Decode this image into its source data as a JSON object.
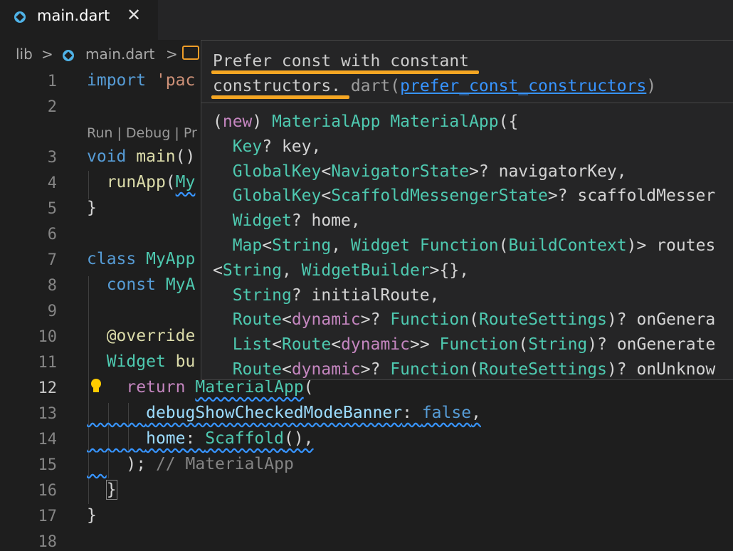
{
  "tab": {
    "title": "main.dart",
    "close": "✕"
  },
  "breadcrumb": {
    "root": "lib",
    "sep": ">",
    "file": "main.dart"
  },
  "codelens": "Run | Debug | Pr",
  "lines": [
    "1",
    "2",
    "3",
    "4",
    "5",
    "6",
    "7",
    "8",
    "9",
    "10",
    "11",
    "12",
    "13",
    "14",
    "15",
    "16",
    "17",
    "18"
  ],
  "code": {
    "l1_kw": "import",
    "l1_str": "'pac",
    "l3_kw": "void",
    "l3_fn": "main",
    "l3_p": "()",
    "l4_fn": "runApp",
    "l4_p": "(",
    "l4_ty": "My",
    "l5": "}",
    "l7_kw": "class",
    "l7_ty": "MyApp",
    "l8_kw": "const",
    "l8_ty": "MyA",
    "l10": "@override",
    "l11_ty": "Widget",
    "l11_fn": "bu",
    "l12_kw": "return",
    "l12_ty": "MaterialApp",
    "l12_p": "(",
    "l13_var": "debugShowCheckedModeBanner",
    "l13_c": ": ",
    "l13_kw": "false",
    "l13_e": ",",
    "l14_var": "home",
    "l14_c": ": ",
    "l14_ty": "Scaffold",
    "l14_e": "(),",
    "l15_p": ");",
    "l15_cm": " // MaterialApp",
    "l16": "}",
    "l17": "}"
  },
  "hover": {
    "msg1": "Prefer const with constant",
    "msg2": "constructors.",
    "source": "dart",
    "paren_open": "(",
    "rule_link": "prefer_const_constructors",
    "paren_close": ")",
    "sig": {
      "new_open": "(",
      "new_kw": "new",
      "new_close": ")",
      "cls": "MaterialApp",
      "ctor": "MaterialApp",
      "ob": "({",
      "p1_ty": "Key",
      "p1": "? key,",
      "p2_ty": "GlobalKey",
      "p2_lt": "<",
      "p2_ty2": "NavigatorState",
      "p2": ">? navigatorKey,",
      "p3_ty": "GlobalKey",
      "p3_lt": "<",
      "p3_ty2": "ScaffoldMessengerState",
      "p3": ">? scaffoldMesser",
      "p4_ty": "Widget",
      "p4": "? home,",
      "p5_ty": "Map",
      "p5_lt": "<",
      "p5_ty2": "String",
      "p5_c": ", ",
      "p5_ty3": "Widget",
      "p5_sp": " ",
      "p5_ty4": "Function",
      "p5_po": "(",
      "p5_ty5": "BuildContext",
      "p5": ")> routes",
      "p6_lt": "<",
      "p6_ty": "String",
      "p6_c": ", ",
      "p6_ty2": "WidgetBuilder",
      "p6": ">{},",
      "p7_ty": "String",
      "p7": "? initialRoute,",
      "p8_ty": "Route",
      "p8_lt": "<",
      "p8_kw": "dynamic",
      "p8_gt": ">? ",
      "p8_ty2": "Function",
      "p8_po": "(",
      "p8_ty3": "RouteSettings",
      "p8": ")? onGenera",
      "p9_ty": "List",
      "p9_lt": "<",
      "p9_ty2": "Route",
      "p9_lt2": "<",
      "p9_kw": "dynamic",
      "p9_gt": ">> ",
      "p9_ty3": "Function",
      "p9_po": "(",
      "p9_ty4": "String",
      "p9": ")? onGenerate",
      "p10_ty": "Route",
      "p10_lt": "<",
      "p10_kw": "dynamic",
      "p10_gt": ">? ",
      "p10_ty2": "Function",
      "p10_po": "(",
      "p10_ty3": "RouteSettings",
      "p10": ")? onUnknow"
    }
  },
  "colors": {
    "highlight": "#f5a623",
    "link": "#3794ff",
    "squiggle": "#3794ff"
  }
}
